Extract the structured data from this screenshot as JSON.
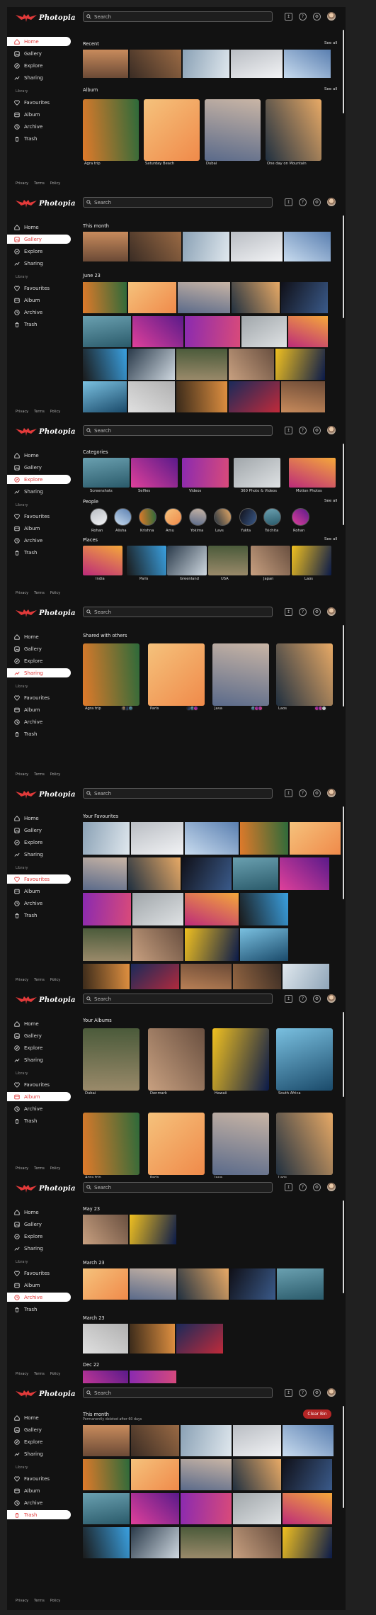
{
  "app": {
    "name": "Photopia",
    "search_placeholder": "Search",
    "footer": [
      "Privacy",
      "Terms",
      "Policy"
    ],
    "library_label": "Library"
  },
  "colors": {
    "accent": "#e23a3a",
    "clear_button": "#b52626",
    "panel": "#121212",
    "page": "#202020"
  },
  "nav": [
    {
      "key": "home",
      "label": "Home",
      "icon": "home-icon"
    },
    {
      "key": "gallery",
      "label": "Gallery",
      "icon": "gallery-icon"
    },
    {
      "key": "explore",
      "label": "Explore",
      "icon": "explore-icon"
    },
    {
      "key": "sharing",
      "label": "Sharing",
      "icon": "sharing-icon"
    },
    {
      "key": "favourites",
      "label": "Favourites",
      "icon": "heart-icon"
    },
    {
      "key": "album",
      "label": "Album",
      "icon": "album-icon"
    },
    {
      "key": "archive",
      "label": "Archive",
      "icon": "archive-icon"
    },
    {
      "key": "trash",
      "label": "Trash",
      "icon": "trash-icon"
    }
  ],
  "screens": [
    {
      "id": "home",
      "active": "home",
      "sections": [
        {
          "title": "Recent",
          "see_all": "See all"
        },
        {
          "title": "Album",
          "see_all": "See all",
          "albums": [
            "Agra trip",
            "Saturday Beach",
            "Dubai",
            "One day on Mountain"
          ]
        }
      ]
    },
    {
      "id": "gallery",
      "active": "gallery",
      "sections": [
        {
          "title": "This month"
        },
        {
          "title": "June 23"
        }
      ]
    },
    {
      "id": "explore",
      "active": "explore",
      "sections": [
        {
          "title": "Categories",
          "items": [
            "Screenshots",
            "Selfies",
            "Videos",
            "360 Photo & Videos",
            "Motion Photos"
          ]
        },
        {
          "title": "People",
          "see_all": "See all",
          "items": [
            "Rohan",
            "Alisha",
            "Krishna",
            "Amu",
            "Yokima",
            "Lavs",
            "Yukta",
            "Tsichita",
            "Rohan"
          ]
        },
        {
          "title": "Places",
          "see_all": "See all",
          "items": [
            "India",
            "Paris",
            "Greenland",
            "USA",
            "Japan",
            "Laos"
          ]
        }
      ]
    },
    {
      "id": "sharing",
      "active": "sharing",
      "sections": [
        {
          "title": "Shared with others",
          "items": [
            "Agra trip",
            "Paris",
            "Java",
            "Laos"
          ]
        }
      ]
    },
    {
      "id": "favourites",
      "active": "favourites",
      "sections": [
        {
          "title": "Your Favourites"
        }
      ]
    },
    {
      "id": "album",
      "active": "album",
      "sections": [
        {
          "title": "Your Albums",
          "items": [
            "Dubai",
            "Denmark",
            "Hawaii",
            "South Africa",
            "Agra trip",
            "Paris",
            "Java",
            "Laos"
          ]
        }
      ]
    },
    {
      "id": "archive",
      "active": "archive",
      "sections": [
        {
          "title": "May 23"
        },
        {
          "title": "March 23"
        },
        {
          "title": "March 23"
        },
        {
          "title": "Dec 22"
        }
      ]
    },
    {
      "id": "trash",
      "active": "trash",
      "sections": [
        {
          "title": "This month",
          "subtitle": "Permanently deleted after 60 days",
          "button": "Clear Bin"
        }
      ]
    }
  ]
}
